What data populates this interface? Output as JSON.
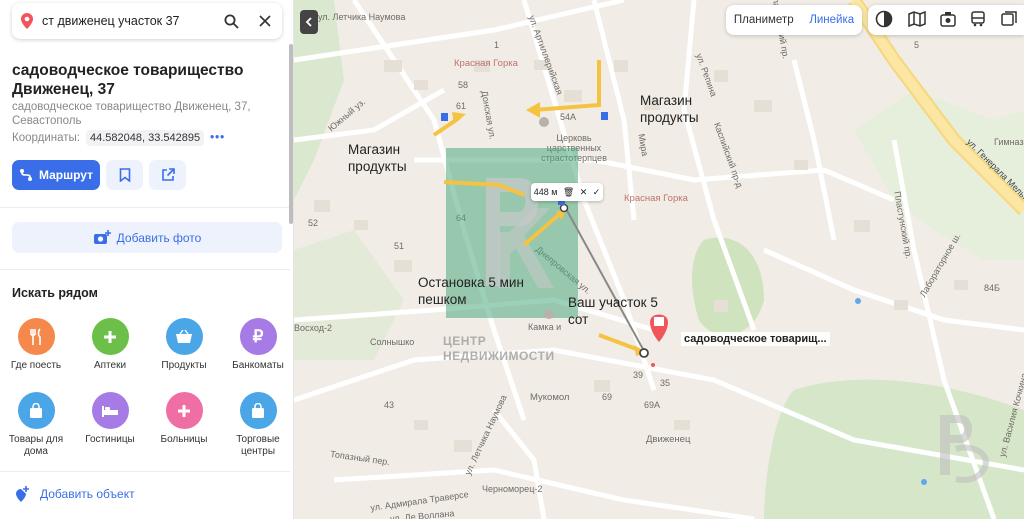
{
  "search": {
    "query": "ст движенец участок 37"
  },
  "place": {
    "title": "садоводческое товарищество Движенец, 37",
    "address": "садоводческое товарищество Движенец, 37, Севастополь",
    "coords_label": "Координаты:",
    "coords_value": "44.582048, 33.542895",
    "more": "•••"
  },
  "actions": {
    "route": "Маршрут",
    "add_photo": "Добавить фото",
    "add_object": "Добавить объект"
  },
  "nearby": {
    "heading": "Искать рядом",
    "items": [
      {
        "label": "Где поесть",
        "icon": "fork-knife-icon",
        "color": "#f5894b"
      },
      {
        "label": "Аптеки",
        "icon": "plus-icon",
        "color": "#6cc04a"
      },
      {
        "label": "Продукты",
        "icon": "basket-icon",
        "color": "#4ba6e8"
      },
      {
        "label": "Банкоматы",
        "icon": "ruble-icon",
        "color": "#a77be6"
      },
      {
        "label": "Товары для дома",
        "icon": "bag-icon",
        "color": "#4ba6e8"
      },
      {
        "label": "Гостиницы",
        "icon": "bed-icon",
        "color": "#a77be6"
      },
      {
        "label": "Больницы",
        "icon": "plus-icon",
        "color": "#ef6fa4"
      },
      {
        "label": "Торговые центры",
        "icon": "bag-icon",
        "color": "#4ba6e8"
      }
    ]
  },
  "map_controls": {
    "planimeter": "Планиметр",
    "ruler": "Линейка"
  },
  "map_labels": {
    "streets": [
      "Красная Горка",
      "Красная Горка",
      "Донская ул.",
      "ул. Артиллерийская",
      "ул. Репина",
      "Пластунский пр.",
      "ул. Генерала Мельника",
      "Пластунский пр.",
      "Лабораторное ш.",
      "Каспийский пр-д",
      "Днепровская ул.",
      "Солнышко",
      "Мукомол",
      "Движенец",
      "Топазный пер.",
      "ул. Адмирала Траверсе",
      "Черноморец-2",
      "ул. Летчика Наумова",
      "ул. Василия Кочкина",
      "Гимназия",
      "Восход-2",
      "Церковь царственных страстотерпцев",
      "Камка и",
      "ул. Де Воллана",
      "Южный уз.",
      "Мира"
    ],
    "house_numbers": [
      "54А",
      "39",
      "35",
      "69А",
      "64",
      "58",
      "61",
      "52",
      "51",
      "84Б",
      "43",
      "69",
      "1",
      "5"
    ],
    "annotations": {
      "shop1": "Магазин продукты",
      "shop2": "Магазин продукты",
      "stop": "Остановка 5 мин пешком",
      "plot": "Ваш участок 5 сот"
    },
    "ruler_distance": "448 м",
    "poi_name": "садоводческое товарищ...",
    "watermark": "ЦЕНТР НЕДВИЖИМОСТИ"
  },
  "colors": {
    "accent": "#3a6ee8",
    "poi": "#f2545b",
    "arrow": "#f5c242",
    "watermark": "#4caa7e"
  }
}
